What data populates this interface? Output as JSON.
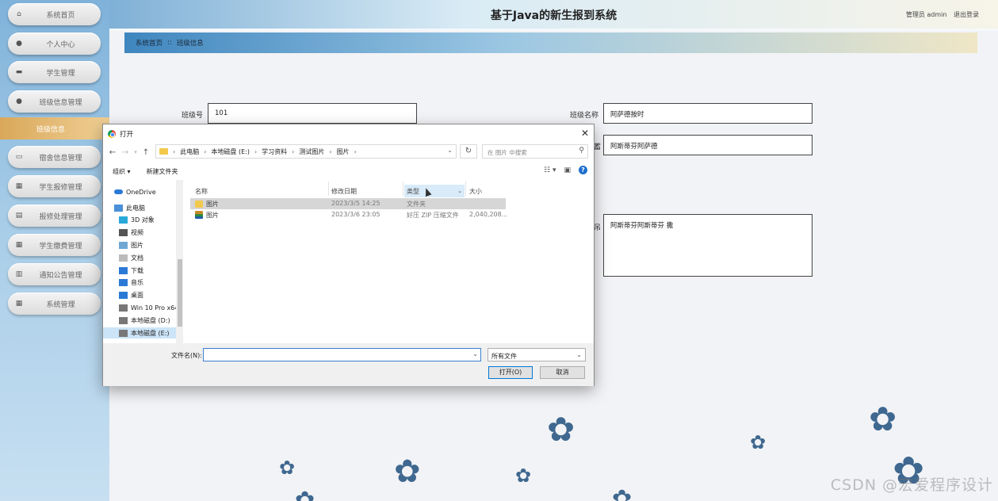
{
  "app": {
    "title": "基于Java的新生报到系统",
    "user": "管理员 admin",
    "logout": "退出登录"
  },
  "sidebar": {
    "items": [
      {
        "label": "系统首页",
        "icon": "home-icon"
      },
      {
        "label": "个人中心",
        "icon": "user-icon"
      },
      {
        "label": "学生管理",
        "icon": "briefcase-icon"
      },
      {
        "label": "班级信息管理",
        "icon": "user-icon"
      },
      {
        "label": "宿舍信息管理",
        "icon": "monitor-icon"
      },
      {
        "label": "学生报修管理",
        "icon": "grid-icon"
      },
      {
        "label": "报修处理管理",
        "icon": "clipboard-icon"
      },
      {
        "label": "学生缴费管理",
        "icon": "grid-icon"
      },
      {
        "label": "通知公告管理",
        "icon": "bar-chart-icon"
      },
      {
        "label": "系统管理",
        "icon": "grid-icon"
      }
    ],
    "active_sub": "班级信息"
  },
  "breadcrumb": {
    "home": "系统首页",
    "sep": "::",
    "current": "班级信息"
  },
  "form": {
    "class_no_label": "班级号",
    "class_no_value": "101",
    "class_name_label": "班级名称",
    "class_name_value": "阿萨德按时",
    "field2_value": "阿斯蒂芬阿萨德",
    "field2_label_partial": "蓄",
    "field3_label_partial": "吊",
    "textarea_value": "阿斯蒂芬阿斯蒂芬 撒"
  },
  "dialog": {
    "title": "打开",
    "path": [
      "此电脑",
      "本地磁盘 (E:)",
      "学习资料",
      "测试图片",
      "图片"
    ],
    "search_placeholder": "在 图片 中搜索",
    "toolbar": {
      "organize": "组织 ▾",
      "new_folder": "新建文件夹"
    },
    "nav_items": [
      {
        "label": "OneDrive",
        "icon": "cloud-icon"
      },
      {
        "label": "此电脑",
        "icon": "computer-icon"
      },
      {
        "label": "3D 对象",
        "icon": "cube-icon"
      },
      {
        "label": "视频",
        "icon": "video-icon"
      },
      {
        "label": "图片",
        "icon": "picture-icon"
      },
      {
        "label": "文档",
        "icon": "document-icon"
      },
      {
        "label": "下载",
        "icon": "download-icon"
      },
      {
        "label": "音乐",
        "icon": "music-icon"
      },
      {
        "label": "桌面",
        "icon": "desktop-icon"
      },
      {
        "label": "Win 10 Pro x64",
        "icon": "drive-icon"
      },
      {
        "label": "本地磁盘 (D:)",
        "icon": "drive-icon"
      },
      {
        "label": "本地磁盘 (E:)",
        "icon": "drive-icon"
      }
    ],
    "columns": [
      "名称",
      "修改日期",
      "类型",
      "大小"
    ],
    "files": [
      {
        "name": "图片",
        "date": "2023/3/5 14:25",
        "type": "文件夹",
        "size": ""
      },
      {
        "name": "图片",
        "date": "2023/3/6 23:05",
        "type": "好压 ZIP 压缩文件",
        "size": "2,040,208..."
      }
    ],
    "filename_label": "文件名(N):",
    "filename_value": "",
    "filetype": "所有文件",
    "open_button": "打开(O)",
    "cancel_button": "取消"
  },
  "watermark": "CSDN @宏爱程序设计",
  "colors": {
    "sidebar_active": "#e2b46a",
    "header_start": "#7fb0d6",
    "clover": "#3f6890",
    "dialog_primary_border": "#0078d7"
  }
}
